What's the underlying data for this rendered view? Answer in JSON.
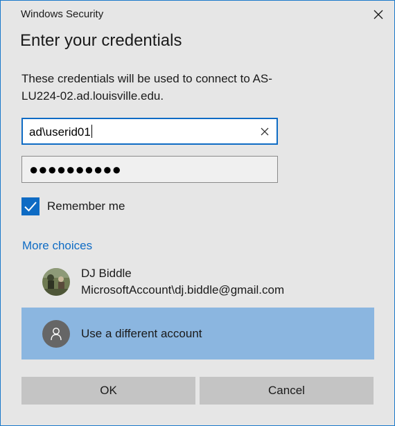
{
  "window": {
    "title": "Windows Security",
    "close_icon": "close-icon"
  },
  "heading": "Enter your credentials",
  "description": "These credentials will be used to connect to AS-LU224-02.ad.louisville.edu.",
  "username": {
    "value": "ad\\userid01",
    "clear_icon": "clear-x-icon"
  },
  "password": {
    "masked_value": "●●●●●●●●●●"
  },
  "remember": {
    "label": "Remember me",
    "checked": true
  },
  "more_choices": "More choices",
  "accounts": [
    {
      "name": "DJ Biddle",
      "detail": "MicrosoftAccount\\dj.biddle@gmail.com",
      "avatar": "user-photo"
    },
    {
      "name": "Use a different account",
      "avatar": "person-icon",
      "selected": true
    }
  ],
  "buttons": {
    "ok": "OK",
    "cancel": "Cancel"
  },
  "colors": {
    "accent": "#0e6bc4",
    "selected_row": "#8bb6e0",
    "background": "#e6e6e6"
  }
}
